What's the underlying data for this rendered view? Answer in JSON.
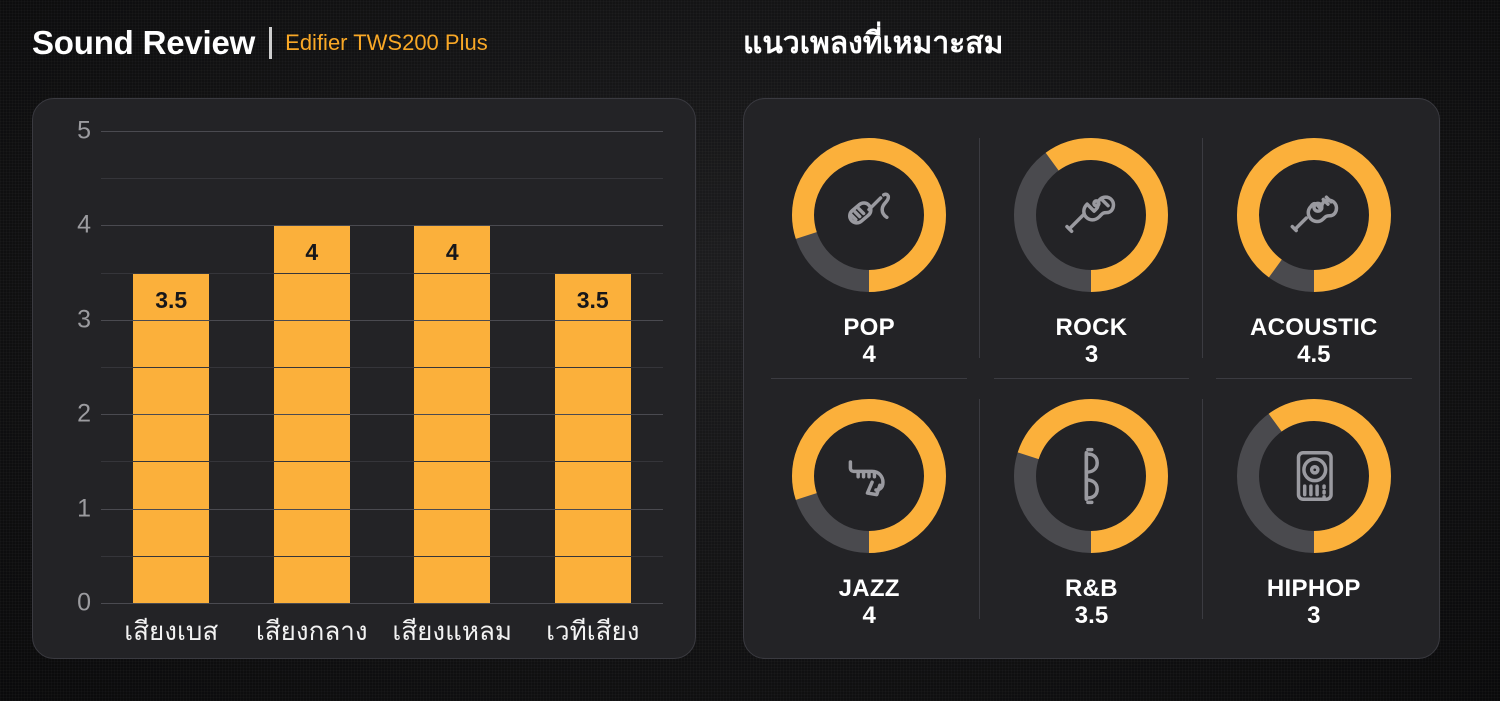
{
  "header": {
    "title_main": "Sound Review",
    "title_sub": "Edifier TWS200 Plus",
    "title_right": "แนวเพลงที่เหมาะสม"
  },
  "colors": {
    "accent": "#FBB03B",
    "accent_text": "#F9A826",
    "panel_bg": "#232326",
    "page_bg": "#111112",
    "track": "#4a4a4e",
    "grid": "#4a4a50",
    "axis_text": "#9b9b9f"
  },
  "chart_data": {
    "type": "bar",
    "title": "Sound Review",
    "subtitle": "Edifier TWS200 Plus",
    "categories": [
      "เสียงเบส",
      "เสียงกลาง",
      "เสียงแหลม",
      "เวทีเสียง"
    ],
    "values": [
      3.5,
      4,
      4,
      3.5
    ],
    "value_labels": [
      "3.5",
      "4",
      "4",
      "3.5"
    ],
    "xlabel": "",
    "ylabel": "",
    "ylim": [
      0,
      5
    ],
    "yticks": [
      0,
      1,
      2,
      3,
      4,
      5
    ],
    "ytick_labels": [
      "0",
      "1",
      "2",
      "3",
      "4",
      "5"
    ],
    "minor_gridlines": [
      0.5,
      1.5,
      2.5,
      3.5,
      4.5
    ],
    "grid": true,
    "legend": false,
    "bar_color": "#FBB03B"
  },
  "genres": {
    "heading": "แนวเพลงที่เหมาะสม",
    "max": 5,
    "items": [
      {
        "name": "POP",
        "score": 4,
        "score_label": "4",
        "percent": 80,
        "icon": "microphone-icon"
      },
      {
        "name": "ROCK",
        "score": 3,
        "score_label": "3",
        "percent": 60,
        "icon": "electric-guitar-icon"
      },
      {
        "name": "ACOUSTIC",
        "score": 4.5,
        "score_label": "4.5",
        "percent": 90,
        "icon": "acoustic-guitar-icon"
      },
      {
        "name": "JAZZ",
        "score": 4,
        "score_label": "4",
        "percent": 80,
        "icon": "saxophone-icon"
      },
      {
        "name": "R&B",
        "score": 3.5,
        "score_label": "3.5",
        "percent": 70,
        "icon": "sunglasses-icon"
      },
      {
        "name": "HIPHOP",
        "score": 3,
        "score_label": "3",
        "percent": 60,
        "icon": "turntable-icon"
      }
    ]
  }
}
